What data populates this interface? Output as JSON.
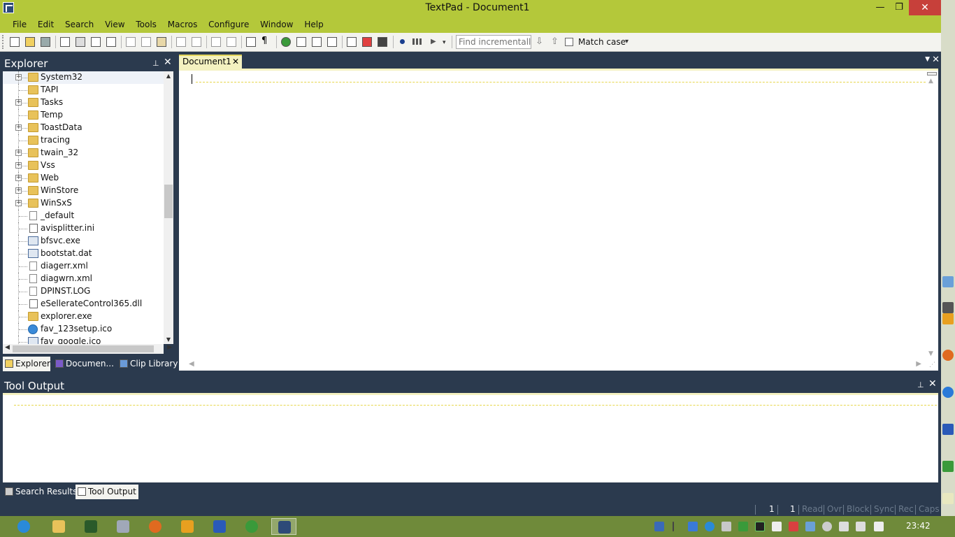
{
  "window": {
    "title": "TextPad - Document1",
    "min_glyph": "—",
    "max_glyph": "❐",
    "close_glyph": "✕"
  },
  "menu": [
    "File",
    "Edit",
    "Search",
    "View",
    "Tools",
    "Macros",
    "Configure",
    "Window",
    "Help"
  ],
  "toolbar": {
    "find_placeholder": "Find incrementally",
    "find_down_glyph": "⇩",
    "find_up_glyph": "⇧",
    "match_case_label": "Match case",
    "more_glyph": "▾"
  },
  "explorer": {
    "title": "Explorer",
    "pin_glyph": "📌",
    "close_glyph": "✕",
    "items": [
      {
        "label": "System32",
        "type": "folder",
        "expandable": true
      },
      {
        "label": "TAPI",
        "type": "folder",
        "expandable": false
      },
      {
        "label": "Tasks",
        "type": "folder",
        "expandable": true
      },
      {
        "label": "Temp",
        "type": "folder",
        "expandable": false
      },
      {
        "label": "ToastData",
        "type": "folder",
        "expandable": true
      },
      {
        "label": "tracing",
        "type": "folder",
        "expandable": false
      },
      {
        "label": "twain_32",
        "type": "folder",
        "expandable": true
      },
      {
        "label": "Vss",
        "type": "folder",
        "expandable": true
      },
      {
        "label": "Web",
        "type": "folder",
        "expandable": true
      },
      {
        "label": "WinStore",
        "type": "folder",
        "expandable": true
      },
      {
        "label": "WinSxS",
        "type": "folder",
        "expandable": true
      },
      {
        "label": "_default",
        "type": "file",
        "expandable": false
      },
      {
        "label": "avisplitter.ini",
        "type": "ini",
        "expandable": false
      },
      {
        "label": "bfsvc.exe",
        "type": "exe",
        "expandable": false
      },
      {
        "label": "bootstat.dat",
        "type": "exe",
        "expandable": false
      },
      {
        "label": "diagerr.xml",
        "type": "file",
        "expandable": false
      },
      {
        "label": "diagwrn.xml",
        "type": "file",
        "expandable": false
      },
      {
        "label": "DPINST.LOG",
        "type": "file",
        "expandable": false
      },
      {
        "label": "eSellerateControl365.dll",
        "type": "ini",
        "expandable": false
      },
      {
        "label": "explorer.exe",
        "type": "folder",
        "expandable": false
      },
      {
        "label": "fav_123setup.ico",
        "type": "globe",
        "expandable": false
      },
      {
        "label": "fav_google.ico",
        "type": "exe",
        "expandable": false
      }
    ],
    "tabs": [
      "Explorer",
      "Documen...",
      "Clip Library"
    ]
  },
  "document": {
    "tab_label": "Document1",
    "tab_close_glyph": "✕",
    "tab_menu_glyph": "▼",
    "area_close_glyph": "✕"
  },
  "tool_output": {
    "title": "Tool Output",
    "pin_glyph": "📌",
    "close_glyph": "✕",
    "tabs": [
      "Search Results",
      "Tool Output"
    ]
  },
  "status": {
    "line": "1",
    "column": "1",
    "flags": [
      "Read",
      "Ovr",
      "Block",
      "Sync",
      "Rec",
      "Caps"
    ]
  },
  "taskbar": {
    "clock": "23:42"
  },
  "colors": {
    "title_bar": "#b4c83a",
    "panel_bg": "#2b3a4e",
    "close_red": "#c7403a",
    "tab_yellow": "#f4f1c0",
    "taskbar": "#6f8a3a"
  }
}
